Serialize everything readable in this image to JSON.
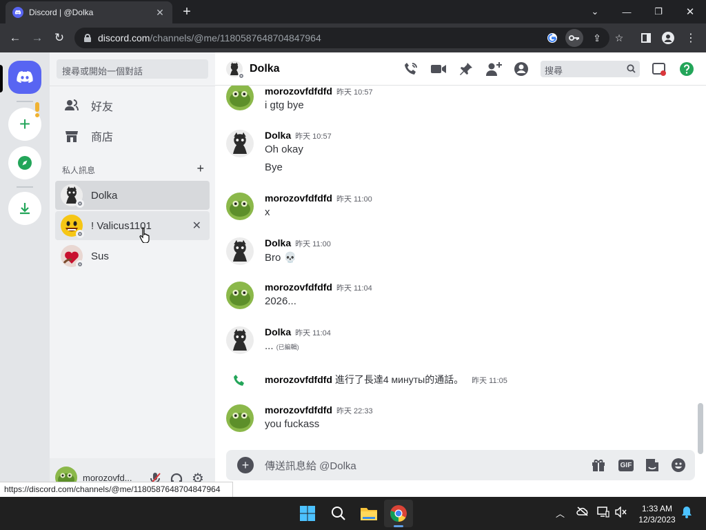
{
  "browser": {
    "tab_title": "Discord | @Dolka",
    "url_host": "discord.com",
    "url_path": "/channels/@me/1180587648704847964",
    "status_url": "https://discord.com/channels/@me/1180587648704847964"
  },
  "sidebar": {
    "search_placeholder": "搜尋或開始一個對話",
    "nav": [
      {
        "label": "好友",
        "icon": "friends-icon"
      },
      {
        "label": "商店",
        "icon": "shop-icon"
      }
    ],
    "dm_header": "私人訊息",
    "dms": [
      {
        "name": "Dolka",
        "selected": true
      },
      {
        "name": "! Valicus1101",
        "hover": true
      },
      {
        "name": "Sus"
      }
    ],
    "user": {
      "name": "morozovfd..."
    }
  },
  "chat": {
    "channel_name": "Dolka",
    "search_placeholder": "搜尋",
    "composer_placeholder": "傳送訊息給 @Dolka",
    "messages": [
      {
        "author": "morozovfdfdfd",
        "time": "昨天 10:57",
        "lines": [
          "i gtg bye"
        ]
      },
      {
        "author": "Dolka",
        "time": "昨天 10:57",
        "lines": [
          "Oh okay",
          "Bye"
        ]
      },
      {
        "author": "morozovfdfdfd",
        "time": "昨天 11:00",
        "lines": [
          "x"
        ]
      },
      {
        "author": "Dolka",
        "time": "昨天 11:00",
        "lines": [
          "Bro 💀"
        ]
      },
      {
        "author": "morozovfdfdfd",
        "time": "昨天 11:04",
        "lines": [
          "2026..."
        ]
      },
      {
        "author": "Dolka",
        "time": "昨天 11:04",
        "lines": [
          "..."
        ],
        "edited": "(已編輯)"
      },
      {
        "author": "morozovfdfdfd",
        "time": "昨天 22:33",
        "lines": [
          "you fuckass"
        ]
      }
    ],
    "call": {
      "author": "morozovfdfdfd",
      "text": "進行了長達4 минуты的通話。",
      "time": "昨天 11:05"
    }
  },
  "taskbar": {
    "time": "1:33 AM",
    "date": "12/3/2023"
  },
  "colors": {
    "blurple": "#5865f2",
    "green": "#23a559",
    "dark": "#202124"
  }
}
